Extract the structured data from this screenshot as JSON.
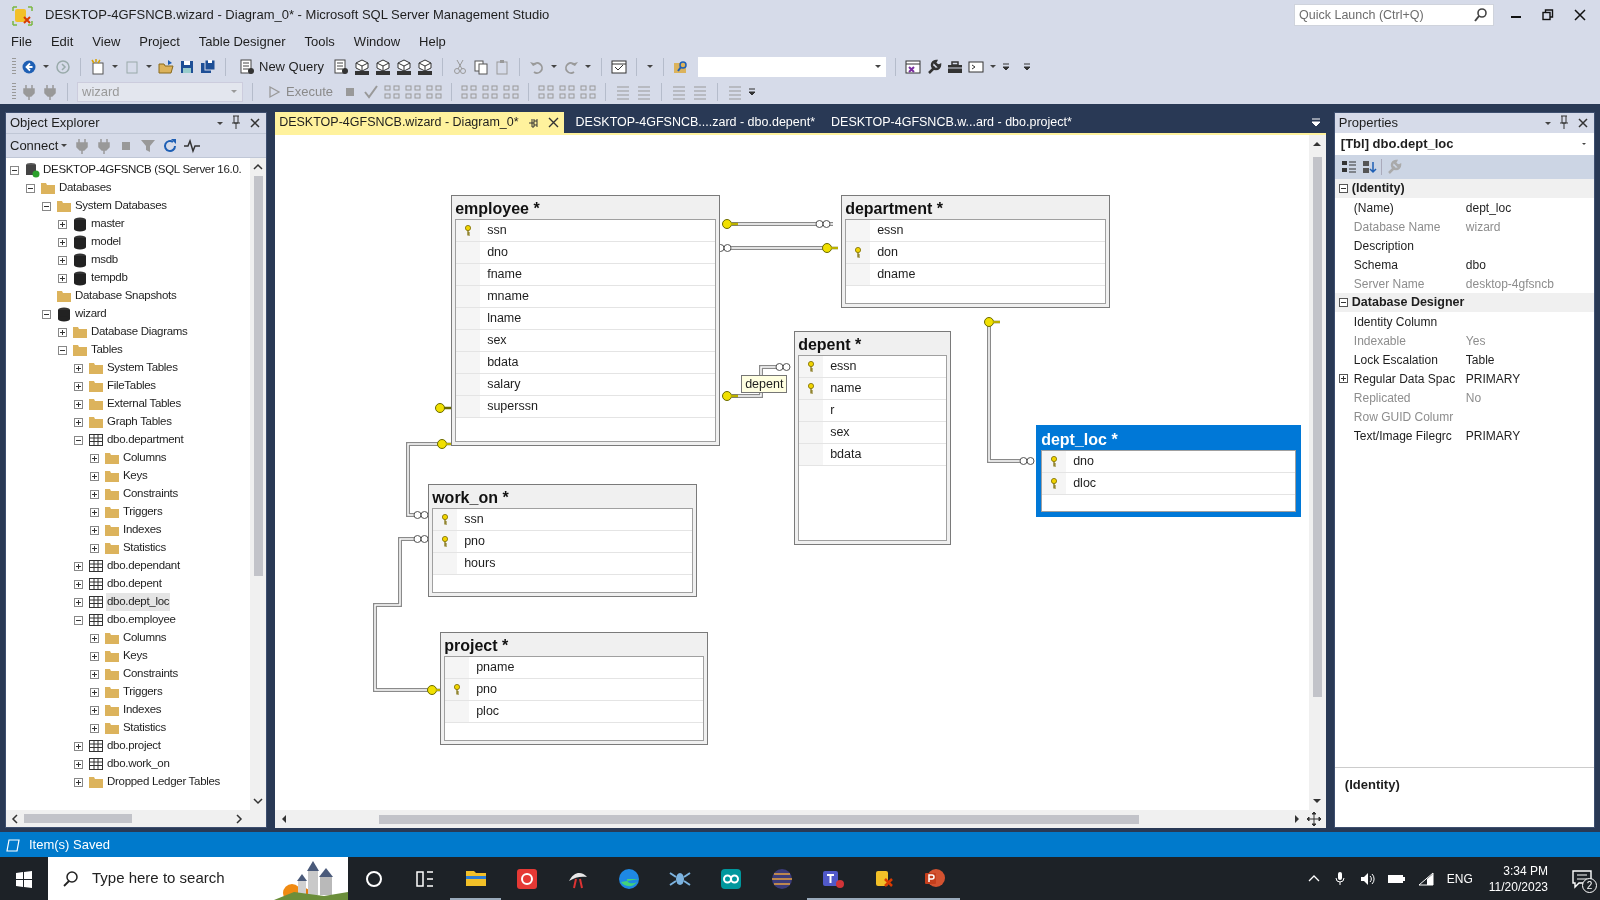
{
  "window": {
    "title": "DESKTOP-4GFSNCB.wizard - Diagram_0* - Microsoft SQL Server Management Studio",
    "quick_launch": {
      "placeholder": "Quick Launch (Ctrl+Q)"
    }
  },
  "menu": [
    "File",
    "Edit",
    "View",
    "Project",
    "Table Designer",
    "Tools",
    "Window",
    "Help"
  ],
  "toolbar": {
    "new_query": "New Query",
    "database": "wizard",
    "execute": "Execute"
  },
  "object_explorer": {
    "title": "Object Explorer",
    "connect": "Connect",
    "tree": [
      {
        "label": "DESKTOP-4GFSNCB (SQL Server 16.0.",
        "kind": "server",
        "expanded": true,
        "selected": false,
        "children": [
          {
            "label": "Databases",
            "kind": "folder",
            "expanded": true,
            "selected": false,
            "children": [
              {
                "label": "System Databases",
                "kind": "folder",
                "expanded": true,
                "selected": false,
                "children": [
                  {
                    "label": "master",
                    "kind": "database",
                    "expanded": false,
                    "selected": false
                  },
                  {
                    "label": "model",
                    "kind": "database",
                    "expanded": false,
                    "selected": false
                  },
                  {
                    "label": "msdb",
                    "kind": "database",
                    "expanded": false,
                    "selected": false
                  },
                  {
                    "label": "tempdb",
                    "kind": "database",
                    "expanded": false,
                    "selected": false
                  }
                ]
              },
              {
                "label": "Database Snapshots",
                "kind": "folder",
                "selected": false
              },
              {
                "label": "wizard",
                "kind": "database",
                "expanded": true,
                "selected": false,
                "children": [
                  {
                    "label": "Database Diagrams",
                    "kind": "folder",
                    "expanded": false,
                    "selected": false
                  },
                  {
                    "label": "Tables",
                    "kind": "folder",
                    "expanded": true,
                    "selected": false,
                    "children": [
                      {
                        "label": "System Tables",
                        "kind": "folder",
                        "expanded": false,
                        "selected": false
                      },
                      {
                        "label": "FileTables",
                        "kind": "folder",
                        "expanded": false,
                        "selected": false
                      },
                      {
                        "label": "External Tables",
                        "kind": "folder",
                        "expanded": false,
                        "selected": false
                      },
                      {
                        "label": "Graph Tables",
                        "kind": "folder",
                        "expanded": false,
                        "selected": false
                      },
                      {
                        "label": "dbo.department",
                        "kind": "table",
                        "expanded": true,
                        "selected": false,
                        "children": [
                          {
                            "label": "Columns",
                            "kind": "folder",
                            "expanded": false,
                            "selected": false
                          },
                          {
                            "label": "Keys",
                            "kind": "folder",
                            "expanded": false,
                            "selected": false
                          },
                          {
                            "label": "Constraints",
                            "kind": "folder",
                            "expanded": false,
                            "selected": false
                          },
                          {
                            "label": "Triggers",
                            "kind": "folder",
                            "expanded": false,
                            "selected": false
                          },
                          {
                            "label": "Indexes",
                            "kind": "folder",
                            "expanded": false,
                            "selected": false
                          },
                          {
                            "label": "Statistics",
                            "kind": "folder",
                            "expanded": false,
                            "selected": false
                          }
                        ]
                      },
                      {
                        "label": "dbo.dependant",
                        "kind": "table",
                        "expanded": false,
                        "selected": false
                      },
                      {
                        "label": "dbo.depent",
                        "kind": "table",
                        "expanded": false,
                        "selected": false
                      },
                      {
                        "label": "dbo.dept_loc",
                        "kind": "table",
                        "expanded": false,
                        "selected": true
                      },
                      {
                        "label": "dbo.employee",
                        "kind": "table",
                        "expanded": true,
                        "selected": false,
                        "children": [
                          {
                            "label": "Columns",
                            "kind": "folder",
                            "expanded": false,
                            "selected": false
                          },
                          {
                            "label": "Keys",
                            "kind": "folder",
                            "expanded": false,
                            "selected": false
                          },
                          {
                            "label": "Constraints",
                            "kind": "folder",
                            "expanded": false,
                            "selected": false
                          },
                          {
                            "label": "Triggers",
                            "kind": "folder",
                            "expanded": false,
                            "selected": false
                          },
                          {
                            "label": "Indexes",
                            "kind": "folder",
                            "expanded": false,
                            "selected": false
                          },
                          {
                            "label": "Statistics",
                            "kind": "folder",
                            "expanded": false,
                            "selected": false
                          }
                        ]
                      },
                      {
                        "label": "dbo.project",
                        "kind": "table",
                        "expanded": false,
                        "selected": false
                      },
                      {
                        "label": "dbo.work_on",
                        "kind": "table",
                        "expanded": false,
                        "selected": false
                      },
                      {
                        "label": "Dropped Ledger Tables",
                        "kind": "folder",
                        "expanded": false,
                        "selected": false
                      }
                    ]
                  }
                ]
              }
            ]
          }
        ]
      }
    ]
  },
  "document_tabs": [
    {
      "label": "DESKTOP-4GFSNCB.wizard - Diagram_0*",
      "selected": true
    },
    {
      "label": "DESKTOP-4GFSNCB....zard - dbo.depent*",
      "selected": false
    },
    {
      "label": "DESKTOP-4GFSNCB.w...ard - dbo.project*",
      "selected": false
    }
  ],
  "diagram": {
    "tables": [
      {
        "name": "employee *",
        "selected": false,
        "columns": [
          {
            "name": "ssn",
            "key": true
          },
          {
            "name": "dno",
            "key": false
          },
          {
            "name": "fname",
            "key": false
          },
          {
            "name": "mname",
            "key": false
          },
          {
            "name": "lname",
            "key": false
          },
          {
            "name": "sex",
            "key": false
          },
          {
            "name": "bdata",
            "key": false
          },
          {
            "name": "salary",
            "key": false
          },
          {
            "name": "superssn",
            "key": false
          }
        ]
      },
      {
        "name": "department *",
        "selected": false,
        "columns": [
          {
            "name": "essn",
            "key": false
          },
          {
            "name": "don",
            "key": true
          },
          {
            "name": "dname",
            "key": false
          }
        ]
      },
      {
        "name": "depent *",
        "selected": false,
        "columns": [
          {
            "name": "essn",
            "key": true
          },
          {
            "name": "name",
            "key": true
          },
          {
            "name": "r",
            "key": false
          },
          {
            "name": "sex",
            "key": false
          },
          {
            "name": "bdata",
            "key": false
          }
        ]
      },
      {
        "name": "dept_loc *",
        "selected": true,
        "columns": [
          {
            "name": "dno",
            "key": true
          },
          {
            "name": "dloc",
            "key": true
          }
        ]
      },
      {
        "name": "work_on *",
        "selected": false,
        "columns": [
          {
            "name": "ssn",
            "key": true
          },
          {
            "name": "pno",
            "key": true
          },
          {
            "name": "hours",
            "key": false
          }
        ]
      },
      {
        "name": "project *",
        "selected": false,
        "columns": [
          {
            "name": "pname",
            "key": false
          },
          {
            "name": "pno",
            "key": true
          },
          {
            "name": "ploc",
            "key": false
          }
        ]
      }
    ],
    "tooltip": "depent"
  },
  "properties": {
    "title": "Properties",
    "object": "[Tbl] dbo.dept_loc",
    "groups": [
      {
        "name": "(Identity)",
        "expanded": true,
        "rows": [
          {
            "name": "(Name)",
            "value": "dept_loc",
            "disabled": false
          },
          {
            "name": "Database Name",
            "value": "wizard",
            "disabled": true
          },
          {
            "name": "Description",
            "disabled": false
          },
          {
            "name": "Schema",
            "value": "dbo",
            "disabled": false
          },
          {
            "name": "Server Name",
            "value": "desktop-4gfsncb",
            "disabled": true
          }
        ]
      },
      {
        "name": "Database Designer",
        "expanded": true,
        "rows": [
          {
            "name": "Identity Column",
            "disabled": false
          },
          {
            "name": "Indexable",
            "value": "Yes",
            "disabled": true
          },
          {
            "name": "Lock Escalation",
            "value": "Table",
            "disabled": false
          },
          {
            "name": "Regular Data Spac",
            "value": "PRIMARY",
            "disabled": false,
            "expanded": false
          },
          {
            "name": "Replicated",
            "value": "No",
            "disabled": true
          },
          {
            "name": "Row GUID Columr",
            "disabled": true
          },
          {
            "name": "Text/Image Filegrc",
            "value": "PRIMARY",
            "disabled": false
          }
        ]
      }
    ],
    "description_title": "(Identity)"
  },
  "status_bar": "Item(s) Saved",
  "taskbar": {
    "search_placeholder": "Type here to search",
    "language": "ENG",
    "time": "3:34 PM",
    "date": "11/20/2023",
    "notifications": "2"
  }
}
